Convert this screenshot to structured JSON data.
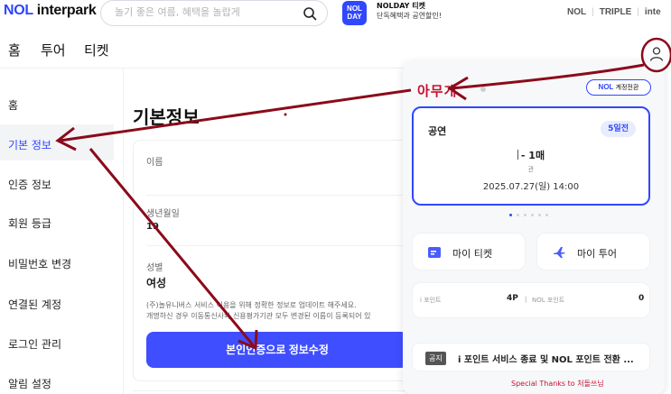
{
  "header": {
    "logo_prefix": "NOL",
    "logo_suffix": " interpark",
    "search_placeholder": "놀기 좋은 여름, 혜택을 놀랍게",
    "nolday_badge_line1": "NOL",
    "nolday_badge_line2": "DAY",
    "nolday_title": "NOLDAY 티켓",
    "nolday_sub": "단독혜택과 공연할인!",
    "brand_links": [
      "NOL",
      "TRIPLE",
      "inte"
    ]
  },
  "nav": {
    "items": [
      "홈",
      "투어",
      "티켓"
    ]
  },
  "sidebar": {
    "items": [
      "홈",
      "기본 정보",
      "인증 정보",
      "회원 등급",
      "비밀번호 변경",
      "연결된 계정",
      "로그인 관리",
      "알림 설정"
    ],
    "active_index": 1
  },
  "main": {
    "title": "기본정보",
    "name_label": "이름",
    "name_value": "",
    "birth_label": "생년월일",
    "birth_value": "19",
    "gender_label": "성별",
    "gender_value": "여성",
    "notice_line1": "(주)놀유니버스 서비스 이용을 위해 정확한 정보로 업데이트 해주세요.",
    "notice_line2": "개명하신 경우 이동통신사와 신용평가기관 모두 변경된 이름이 등록되어 있",
    "verify_button": "본인인증으로 정보수정"
  },
  "panel": {
    "user_name": "아무개",
    "switch_prefix": "NOL",
    "switch_label": " 계정전환",
    "ticket": {
      "type": "공연",
      "dday": "5일전",
      "count": "- 1매",
      "venue": "관",
      "datetime": "2025.07.27(일) 14:00"
    },
    "carousel_total": 6,
    "carousel_active": 1,
    "my_ticket": "마이 티켓",
    "my_tour": "마이 투어",
    "i_point_label": "i 포인트",
    "i_point_value": "4P",
    "nol_point_label": "NOL 포인트",
    "nol_point_value": "0",
    "notice_tag": "공지",
    "notice_text": "i 포인트 서비스 종료 및 NOL 포인트 전환 ...",
    "thanks": "Special Thanks to 처돌쓰님"
  },
  "colors": {
    "brand_blue": "#3047ff",
    "annotation_red": "#8b0a1a",
    "name_red": "#c8102e"
  }
}
